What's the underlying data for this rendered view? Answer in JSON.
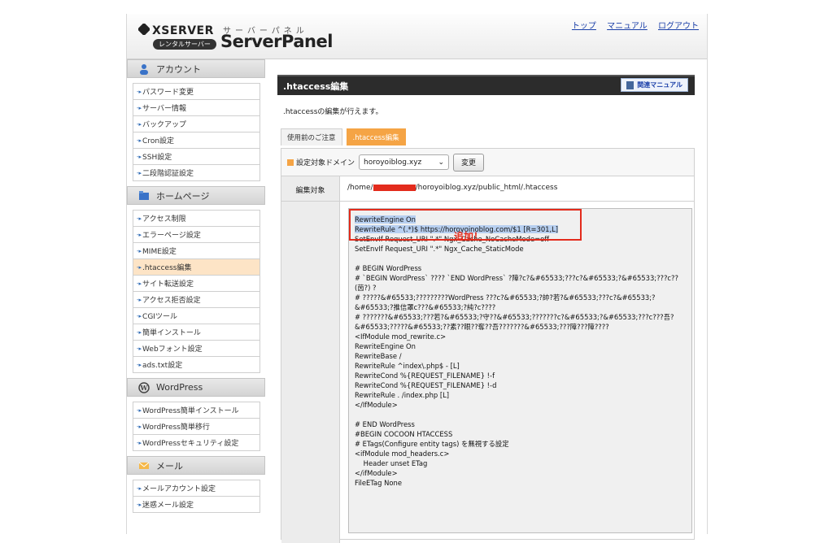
{
  "header": {
    "logo_xserver": "XSERVER",
    "logo_rental": "レンタルサーバー",
    "logo_sub": "サーバーパネル",
    "logo_panel": "ServerPanel",
    "links": [
      "トップ",
      "マニュアル",
      "ログアウト"
    ]
  },
  "sidebar": {
    "sections": [
      {
        "title": "アカウント",
        "icon": "user-icon",
        "items": [
          "パスワード変更",
          "サーバー情報",
          "バックアップ",
          "Cron設定",
          "SSH設定",
          "二段階認証設定"
        ]
      },
      {
        "title": "ホームページ",
        "icon": "folder-icon",
        "items": [
          "アクセス制限",
          "エラーページ設定",
          "MIME設定",
          ".htaccess編集",
          "サイト転送設定",
          "アクセス拒否設定",
          "CGIツール",
          "簡単インストール",
          "Webフォント設定",
          "ads.txt設定"
        ]
      },
      {
        "title": "WordPress",
        "icon": "wordpress-icon",
        "items": [
          "WordPress簡単インストール",
          "WordPress簡単移行",
          "WordPressセキュリティ設定"
        ]
      },
      {
        "title": "メール",
        "icon": "mail-icon",
        "items": [
          "メールアカウント設定",
          "迷惑メール設定"
        ]
      }
    ],
    "active_item": ".htaccess編集"
  },
  "main": {
    "title": ".htaccess編集",
    "manual_button": "関連マニュアル",
    "description": ".htaccessの編集が行えます。",
    "tabs": [
      "使用前のご注意",
      ".htaccess編集"
    ],
    "active_tab": ".htaccess編集",
    "domain_label": "設定対象ドメイン",
    "domain_value": "horoyoiblog.xyz",
    "change_button": "変更",
    "target_label": "編集対象",
    "path_prefix": "/home/",
    "path_suffix": "/horoyoiblog.xyz/public_html/.htaccess",
    "callout_text": "追加！"
  },
  "editor": {
    "highlighted": "RewriteEngine On\nRewriteRule ^(.*)$ https://horoyoinoblog.com/$1 [R=301,L]",
    "body": "\nSetEnvIf Request_URI \".*\" Ngx_Cache_NoCacheMode=off\nSetEnvIf Request_URI \".*\" Ngx_Cache_StaticMode\n\n# BEGIN WordPress\n# `BEGIN WordPress` ???? `END WordPress` ?障?c?&#65533;???c?&#65533;?&#65533;???c?? (茵?) ?\n# ?????&#65533;?????????WordPress ???c?&#65533;?帥?若?&#65533;???c?&#65533;?&#65533;?推信罩c???&#65533;?純?c????\n# ???????&#65533;???若?&#65533;?守??&#65533;???????c?&#65533;?&#65533;???c???吾?&#65533;?????&#65533;??素??眼??奪??吾???????&#65533;???障???障????\n<IfModule mod_rewrite.c>\nRewriteEngine On\nRewriteBase /\nRewriteRule ^index\\.php$ - [L]\nRewriteCond %{REQUEST_FILENAME} !-f\nRewriteCond %{REQUEST_FILENAME} !-d\nRewriteRule . /index.php [L]\n</IfModule>\n\n# END WordPress\n#BEGIN COCOON HTACCESS\n# ETags(Configure entity tags) を無視する設定\n<ifModule mod_headers.c>\n    Header unset ETag\n</ifModule>\nFileETag None"
  }
}
